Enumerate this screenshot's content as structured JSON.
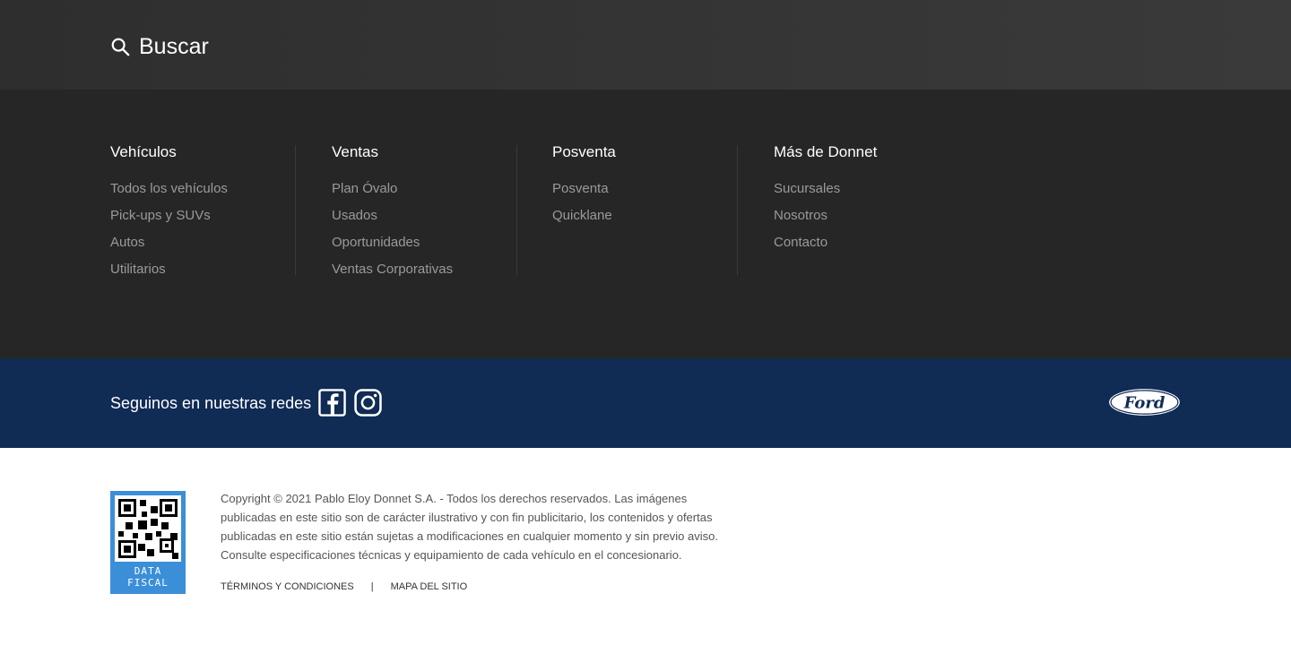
{
  "search": {
    "label": "Buscar",
    "icon": "search-icon"
  },
  "columns": [
    {
      "title": "Vehículos",
      "links": [
        "Todos los vehículos",
        "Pick-ups y SUVs",
        "Autos",
        "Utilitarios"
      ]
    },
    {
      "title": "Ventas",
      "links": [
        "Plan Óvalo",
        "Usados",
        "Oportunidades",
        "Ventas Corporativas"
      ]
    },
    {
      "title": "Posventa",
      "links": [
        "Posventa",
        "Quicklane"
      ]
    },
    {
      "title": "Más de Donnet",
      "links": [
        "Sucursales",
        "Nosotros",
        "Contacto"
      ]
    }
  ],
  "social": {
    "label": "Seguinos en nuestras redes",
    "icons": [
      "facebook-icon",
      "instagram-icon"
    ],
    "brand_logo_text": "Ford"
  },
  "footer": {
    "qr_text": [
      "DATA",
      "FISCAL"
    ],
    "copyright": "Copyright © 2021 Pablo Eloy Donnet S.A. - Todos los derechos reservados. Las imágenes publicadas en este sitio son de carácter ilustrativo y con fin publicitario, los contenidos y ofertas publicadas en este sitio están sujetas a modificaciones en cualquier momento y sin previo aviso. Consulte especificaciones técnicas y equipamiento de cada vehículo en el concesionario.",
    "links": [
      "TÉRMINOS Y CONDICIONES",
      "MAPA DEL SITIO"
    ],
    "separator": "|"
  },
  "colors": {
    "search_bg": "#333333",
    "links_bg": "#262626",
    "social_bg": "#102b54",
    "qr_bg": "#3b8fd8",
    "link_gray": "#9a9a9a"
  }
}
